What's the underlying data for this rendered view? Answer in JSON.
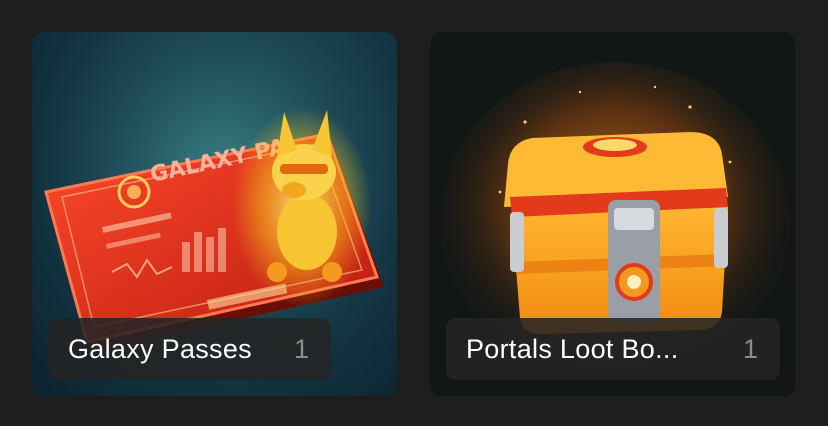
{
  "collections": [
    {
      "name": "Galaxy Passes",
      "count": "1",
      "icon": "galaxy-pass-card-image",
      "card_text": "GALAXY PA"
    },
    {
      "name": "Portals Loot Bo...",
      "count": "1",
      "icon": "loot-box-chest-image"
    }
  ],
  "colors": {
    "background": "#1e1e1e",
    "pill": "#242424",
    "count_text": "#8e8e8e",
    "name_text": "#ffffff"
  }
}
